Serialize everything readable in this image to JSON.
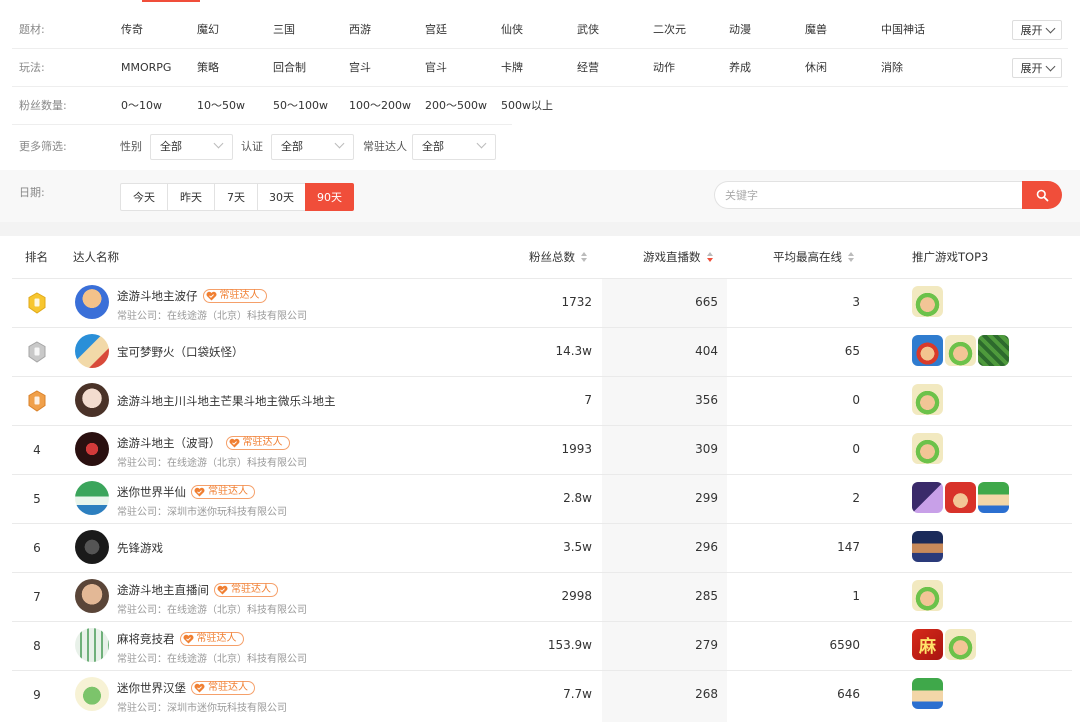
{
  "filters": {
    "theme": {
      "label": "题材:",
      "options": [
        "传奇",
        "魔幻",
        "三国",
        "西游",
        "宫廷",
        "仙侠",
        "武侠",
        "二次元",
        "动漫",
        "魔兽",
        "中国神话"
      ],
      "expand": "展开"
    },
    "gameplay": {
      "label": "玩法:",
      "options": [
        "MMORPG",
        "策略",
        "回合制",
        "宫斗",
        "官斗",
        "卡牌",
        "经营",
        "动作",
        "养成",
        "休闲",
        "消除"
      ],
      "expand": "展开"
    },
    "fans": {
      "label": "粉丝数量:",
      "options": [
        "0～10w",
        "10～50w",
        "50～100w",
        "100～200w",
        "200～500w",
        "500w以上"
      ]
    },
    "more": {
      "label": "更多筛选:",
      "gender_label": "性别",
      "gender_value": "全部",
      "verify_label": "认证",
      "verify_value": "全部",
      "resident_label": "常驻达人",
      "resident_value": "全部"
    },
    "date": {
      "label": "日期:",
      "options": [
        "今天",
        "昨天",
        "7天",
        "30天",
        "90天"
      ],
      "selected": "90天"
    },
    "search": {
      "placeholder": "关键字"
    }
  },
  "table": {
    "headers": {
      "rank": "排名",
      "name": "达人名称",
      "fans": "粉丝总数",
      "live": "游戏直播数",
      "online": "平均最高在线",
      "games": "推广游戏TOP3"
    },
    "sorted_column": "live",
    "badge_text": "常驻达人",
    "rows": [
      {
        "rank": "",
        "medal": "gold",
        "name": "途游斗地主波仔",
        "badge": true,
        "company": "常驻公司：在线途游（北京）科技有限公司",
        "fans": "1732",
        "live": "665",
        "online": "3",
        "games": [
          "farmer"
        ]
      },
      {
        "rank": "",
        "medal": "silver",
        "name": "宝可梦野火（口袋妖怪）",
        "badge": false,
        "company": "",
        "fans": "14.3w",
        "live": "404",
        "online": "65",
        "games": [
          "pirate",
          "farmer",
          "forest"
        ]
      },
      {
        "rank": "",
        "medal": "bronze",
        "name": "途游斗地主川斗地主芒果斗地主微乐斗地主",
        "badge": false,
        "company": "",
        "fans": "7",
        "live": "356",
        "online": "0",
        "games": [
          "farmer"
        ]
      },
      {
        "rank": "4",
        "name": "途游斗地主（波哥）",
        "badge": true,
        "company": "常驻公司：在线途游（北京）科技有限公司",
        "fans": "1993",
        "live": "309",
        "online": "0",
        "games": [
          "farmer"
        ]
      },
      {
        "rank": "5",
        "name": "迷你世界半仙",
        "badge": true,
        "company": "常驻公司：深圳市迷你玩科技有限公司",
        "fans": "2.8w",
        "live": "299",
        "online": "2",
        "games": [
          "anime",
          "redhair",
          "block"
        ]
      },
      {
        "rank": "6",
        "name": "先锋游戏",
        "badge": false,
        "company": "",
        "fans": "3.5w",
        "live": "296",
        "online": "147",
        "games": [
          "hero"
        ]
      },
      {
        "rank": "7",
        "name": "途游斗地主直播间",
        "badge": true,
        "company": "常驻公司：在线途游（北京）科技有限公司",
        "fans": "2998",
        "live": "285",
        "online": "1",
        "games": [
          "farmer"
        ]
      },
      {
        "rank": "8",
        "name": "麻将竞技君",
        "badge": true,
        "company": "常驻公司：在线途游（北京）科技有限公司",
        "fans": "153.9w",
        "live": "279",
        "online": "6590",
        "games": [
          "mahjong",
          "farmer"
        ]
      },
      {
        "rank": "9",
        "name": "迷你世界汉堡",
        "badge": true,
        "company": "常驻公司：深圳市迷你玩科技有限公司",
        "fans": "7.7w",
        "live": "268",
        "online": "646",
        "games": [
          "block"
        ]
      }
    ],
    "mahjong_glyph": "麻"
  },
  "colors": {
    "accent": "#f04e3a",
    "badge": "#f07f32"
  }
}
